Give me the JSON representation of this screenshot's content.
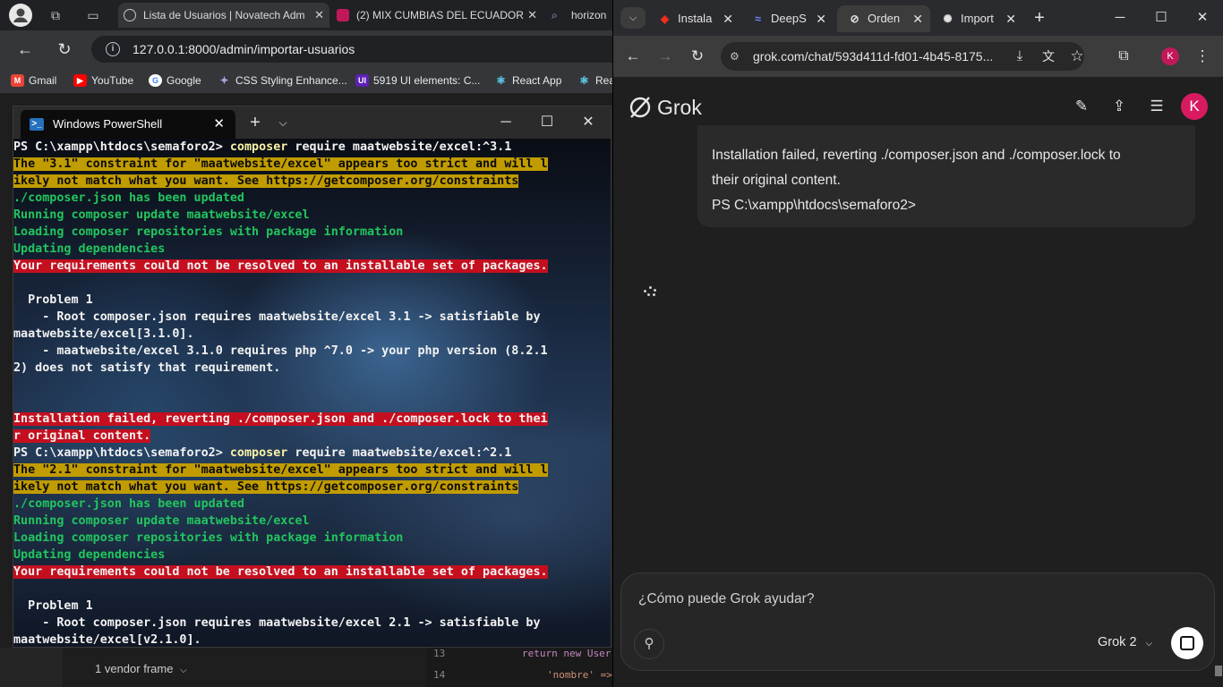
{
  "left_browser": {
    "tabs": [
      {
        "label": "Lista de Usuarios | Novatech Adm"
      },
      {
        "label": "(2) MIX CUMBIAS DEL ECUADOR"
      },
      {
        "label": "horizon"
      }
    ],
    "url": "127.0.0.1:8000/admin/importar-usuarios",
    "bookmarks": [
      {
        "label": "Gmail",
        "icon": "gmail-icon"
      },
      {
        "label": "YouTube",
        "icon": "youtube-icon"
      },
      {
        "label": "Google",
        "icon": "google-icon"
      },
      {
        "label": "CSS Styling Enhance...",
        "icon": "css-icon"
      },
      {
        "label": "5919 UI elements: C...",
        "icon": "uiverse-icon"
      },
      {
        "label": "React App",
        "icon": "react-icon"
      },
      {
        "label": "Rea",
        "icon": "react-icon"
      }
    ],
    "behind": {
      "vendor_frame": "1 vendor frame",
      "line_13": "13",
      "line_14": "14",
      "code_13": "return new User",
      "code_14": "'nombre' =>"
    }
  },
  "powershell": {
    "title": "Windows PowerShell",
    "lines": [
      {
        "parts": [
          {
            "t": "PS C:\\xampp\\htdocs\\semaforo2> ",
            "c": "c-w"
          },
          {
            "t": "composer",
            "c": "c-y"
          },
          {
            "t": " require maatwebsite/excel:^3.1",
            "c": "c-w"
          }
        ]
      },
      {
        "parts": [
          {
            "t": "The \"3.1\" constraint for \"maatwebsite/excel\" appears too strict and will l",
            "c": "bg-y"
          }
        ]
      },
      {
        "parts": [
          {
            "t": "ikely not match what you want. See https://getcomposer.org/constraints",
            "c": "bg-y"
          }
        ]
      },
      {
        "parts": [
          {
            "t": "./composer.json has been updated",
            "c": "c-g"
          }
        ]
      },
      {
        "parts": [
          {
            "t": "Running composer update maatwebsite/excel",
            "c": "c-g"
          }
        ]
      },
      {
        "parts": [
          {
            "t": "Loading composer repositories with package information",
            "c": "c-g"
          }
        ]
      },
      {
        "parts": [
          {
            "t": "Updating dependencies",
            "c": "c-g"
          }
        ]
      },
      {
        "parts": [
          {
            "t": "Your requirements could not be resolved to an installable set of packages.",
            "c": "bg-r"
          }
        ]
      },
      {
        "parts": [
          {
            "t": "",
            "c": "c-w"
          }
        ]
      },
      {
        "parts": [
          {
            "t": "  Problem 1",
            "c": "c-w"
          }
        ]
      },
      {
        "parts": [
          {
            "t": "    - Root composer.json requires maatwebsite/excel 3.1 -> satisfiable by",
            "c": "c-w"
          }
        ]
      },
      {
        "parts": [
          {
            "t": "maatwebsite/excel[3.1.0].",
            "c": "c-w"
          }
        ]
      },
      {
        "parts": [
          {
            "t": "    - maatwebsite/excel 3.1.0 requires php ^7.0 -> your php version (8.2.1",
            "c": "c-w"
          }
        ]
      },
      {
        "parts": [
          {
            "t": "2) does not satisfy that requirement.",
            "c": "c-w"
          }
        ]
      },
      {
        "parts": [
          {
            "t": "",
            "c": "c-w"
          }
        ]
      },
      {
        "parts": [
          {
            "t": "",
            "c": "c-w"
          }
        ]
      },
      {
        "parts": [
          {
            "t": "Installation failed, reverting ./composer.json and ./composer.lock to thei",
            "c": "bg-r"
          }
        ]
      },
      {
        "parts": [
          {
            "t": "r original content.",
            "c": "bg-r"
          }
        ]
      },
      {
        "parts": [
          {
            "t": "PS C:\\xampp\\htdocs\\semaforo2> ",
            "c": "c-w"
          },
          {
            "t": "composer",
            "c": "c-y"
          },
          {
            "t": " require maatwebsite/excel:^2.1",
            "c": "c-w"
          }
        ]
      },
      {
        "parts": [
          {
            "t": "The \"2.1\" constraint for \"maatwebsite/excel\" appears too strict and will l",
            "c": "bg-y"
          }
        ]
      },
      {
        "parts": [
          {
            "t": "ikely not match what you want. See https://getcomposer.org/constraints",
            "c": "bg-y"
          }
        ]
      },
      {
        "parts": [
          {
            "t": "./composer.json has been updated",
            "c": "c-g"
          }
        ]
      },
      {
        "parts": [
          {
            "t": "Running composer update maatwebsite/excel",
            "c": "c-g"
          }
        ]
      },
      {
        "parts": [
          {
            "t": "Loading composer repositories with package information",
            "c": "c-g"
          }
        ]
      },
      {
        "parts": [
          {
            "t": "Updating dependencies",
            "c": "c-g"
          }
        ]
      },
      {
        "parts": [
          {
            "t": "Your requirements could not be resolved to an installable set of packages.",
            "c": "bg-r"
          }
        ]
      },
      {
        "parts": [
          {
            "t": "",
            "c": "c-w"
          }
        ]
      },
      {
        "parts": [
          {
            "t": "  Problem 1",
            "c": "c-w"
          }
        ]
      },
      {
        "parts": [
          {
            "t": "    - Root composer.json requires maatwebsite/excel 2.1 -> satisfiable by",
            "c": "c-w"
          }
        ]
      },
      {
        "parts": [
          {
            "t": "maatwebsite/excel[v2.1.0].",
            "c": "c-w"
          }
        ]
      }
    ]
  },
  "right_browser": {
    "tabs": [
      {
        "label": "Instala",
        "icon": "laravel-icon"
      },
      {
        "label": "DeepS",
        "icon": "deepseek-icon"
      },
      {
        "label": "Orden",
        "icon": "grok-icon"
      },
      {
        "label": "Import",
        "icon": "openai-icon"
      }
    ],
    "url": "grok.com/chat/593d411d-fd01-4b45-8175...",
    "profile_initial": "K",
    "app_name": "Grok",
    "message_lines": [
      "Installation failed, reverting ./composer.json and ./composer.lock to",
      "their original content.",
      "PS C:\\xampp\\htdocs\\semaforo2>"
    ],
    "input_placeholder": "¿Cómo puede Grok ayudar?",
    "model": "Grok 2"
  },
  "colors": {
    "ps_yellow_bg": "#c19c00",
    "ps_red_bg": "#c50f1f",
    "ps_green": "#22c55e",
    "avatar": "#d81b60"
  }
}
